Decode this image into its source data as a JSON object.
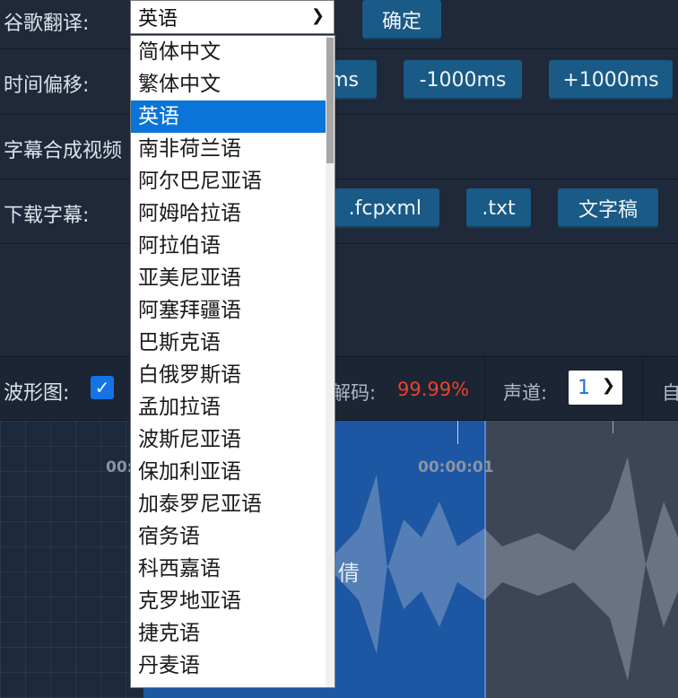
{
  "translate": {
    "label": "谷歌翻译:",
    "selected": "英语",
    "confirm_label": "确定"
  },
  "offset": {
    "label": "时间偏移:",
    "btn_partial": "ms",
    "minus_1000": "-1000ms",
    "plus_1000": "+1000ms"
  },
  "compose": {
    "label": "字幕合成视频"
  },
  "download": {
    "label": "下载字幕:",
    "fcpxml": ".fcpxml",
    "txt": ".txt",
    "transcript": "文字稿"
  },
  "dropdown": {
    "options": [
      "简体中文",
      "繁体中文",
      "英语",
      "南非荷兰语",
      "阿尔巴尼亚语",
      "阿姆哈拉语",
      "阿拉伯语",
      "亚美尼亚语",
      "阿塞拜疆语",
      "巴斯克语",
      "白俄罗斯语",
      "孟加拉语",
      "波斯尼亚语",
      "保加利亚语",
      "加泰罗尼亚语",
      "宿务语",
      "科西嘉语",
      "克罗地亚语",
      "捷克语",
      "丹麦语"
    ],
    "selected_index": 2
  },
  "toolbar": {
    "waveform_label": "波形图:",
    "decode_label": "解码:",
    "decode_value": "99.99%",
    "channel_label": "声道:",
    "channel_value": "1",
    "partial_right": "自"
  },
  "waveform": {
    "time_left": "00:",
    "time_mid": "00:00:01",
    "subtitle_partial": "倩"
  },
  "colors": {
    "decode_value": "#e8432e",
    "accent": "#1473e6"
  }
}
